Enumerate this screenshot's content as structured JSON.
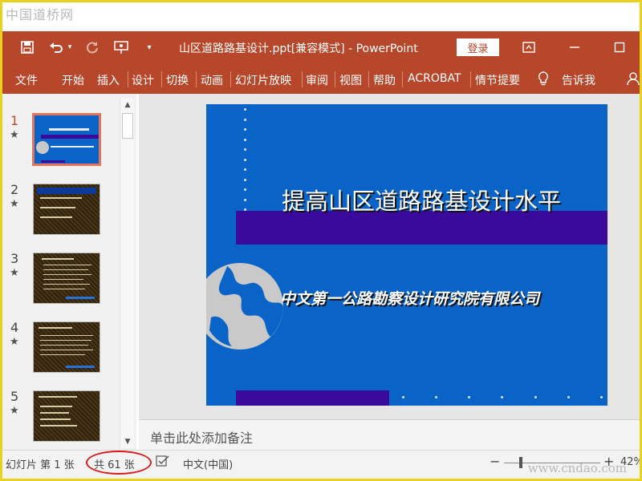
{
  "watermark": {
    "top": "中国道桥网",
    "bottom": "www.cndao.com"
  },
  "titlebar": {
    "file_title": "山区道路路基设计.ppt[兼容模式]  -  PowerPoint",
    "login_label": "登录",
    "icons": [
      "save-icon",
      "undo-icon",
      "undo-dropdown-icon",
      "redo-icon",
      "present-from-start-icon",
      "customize-qat-icon",
      "ribbon-display-icon",
      "minimize-icon",
      "maximize-icon"
    ]
  },
  "ribbon": {
    "tabs": [
      "文件",
      "开始",
      "插入",
      "设计",
      "切换",
      "动画",
      "幻灯片放映",
      "审阅",
      "视图",
      "帮助",
      "ACROBAT",
      "情节提要"
    ],
    "tell_me": "告诉我",
    "icons": [
      "lightbulb-icon",
      "share-icon"
    ]
  },
  "thumbnails": [
    {
      "number": "1",
      "star": "★",
      "style": "blue",
      "active": true
    },
    {
      "number": "2",
      "star": "★",
      "style": "brown",
      "active": false
    },
    {
      "number": "3",
      "star": "★",
      "style": "brown",
      "active": false
    },
    {
      "number": "4",
      "star": "★",
      "style": "brown",
      "active": false
    },
    {
      "number": "5",
      "star": "★",
      "style": "brown",
      "active": false
    }
  ],
  "slide": {
    "title": "提高山区道路路基设计水平",
    "subtitle": "中文第一公路勘察设计研究院有限公司",
    "background_color": "#0a64c8",
    "band_color": "#3a0a9c"
  },
  "notes": {
    "placeholder": "单击此处添加备注"
  },
  "status": {
    "slide_position": "幻灯片 第 1 张",
    "slide_total": "共 61 张",
    "language": "中文(中国)",
    "zoom_minus": "−",
    "zoom_plus": "+",
    "zoom_percent": "42%",
    "zoom_level": 0.42
  },
  "colors": {
    "accent": "#b7472a",
    "highlight_oval": "#d81c1c",
    "frame": "#e8d21c"
  }
}
